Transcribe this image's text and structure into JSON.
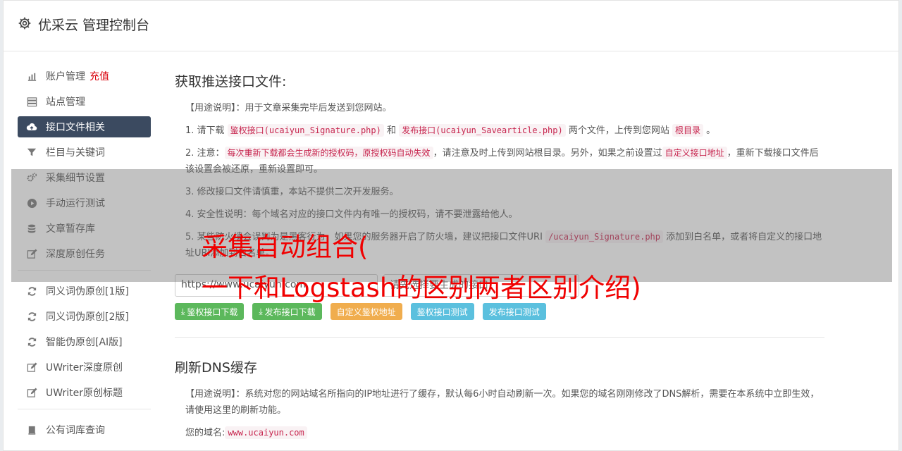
{
  "header": {
    "title": "优采云 管理控制台"
  },
  "sidebar": {
    "group1": [
      {
        "icon": "bar-chart-icon",
        "label": "账户管理",
        "extra": "充值"
      },
      {
        "icon": "server-icon",
        "label": "站点管理"
      },
      {
        "icon": "cloud-upload-icon",
        "label": "接口文件相关",
        "active": true
      },
      {
        "icon": "filter-icon",
        "label": "栏目与关键词"
      },
      {
        "icon": "gears-icon",
        "label": "采集细节设置"
      },
      {
        "icon": "play-icon",
        "label": "手动运行测试"
      },
      {
        "icon": "database-icon",
        "label": "文章暂存库"
      },
      {
        "icon": "edit-icon",
        "label": "深度原创任务"
      }
    ],
    "group2": [
      {
        "icon": "refresh-icon",
        "label": "同义词伪原创[1版]"
      },
      {
        "icon": "refresh-icon",
        "label": "同义词伪原创[2版]"
      },
      {
        "icon": "refresh-icon",
        "label": "智能伪原创[AI版]"
      },
      {
        "icon": "edit-icon",
        "label": "UWriter深度原创"
      },
      {
        "icon": "edit-icon",
        "label": "UWriter原创标题"
      }
    ],
    "group3": [
      {
        "icon": "book-icon",
        "label": "公有词库查询"
      }
    ]
  },
  "section1": {
    "title": "获取推送接口文件:",
    "usage": "【用途说明】：用于文章采集完毕后发送到您网站。",
    "item1": {
      "t1": "1. 请下载 ",
      "c1": "鉴权接口(ucaiyun_Signature.php)",
      "t2": " 和 ",
      "c2": "发布接口(ucaiyun_Savearticle.php)",
      "t3": " 两个文件，上传到您网站 ",
      "c3": "根目录",
      "t4": " 。"
    },
    "item2": {
      "t1": "2. 注意：",
      "c1": "每次重新下载都会生成新的授权码，原授权码自动失效",
      "t2": "，请注意及时上传到网站根目录。另外，如果之前设置过",
      "c2": "自定义接口地址",
      "t3": "，重新下载接口文件后该设置会被还原，重新设置即可。"
    },
    "item3": "3. 修改接口文件请慎重，本站不提供二次开发服务。",
    "item4": "4. 安全性说明：每个域名对应的接口文件内有唯一的授权码，请不要泄露给他人。",
    "item5": {
      "t1": "5. 某些防火墙会误判为是黑客行为，如果您的服务器开启了防火墙，建议把接口文件URI ",
      "c1": "/ucaiyun_Signature.php",
      "t2": " 添加到白名单，或者将自定义的接口地址URI添加到白名单。"
    },
    "protocol": "https://www.ucaiyun.com",
    "path_placeholder": "请先选择要生成的接口",
    "buttons": {
      "dl_auth": "鉴权接口下载",
      "dl_publish": "发布接口下载",
      "custom_auth": "自定义鉴权地址",
      "test_auth": "鉴权接口测试",
      "test_publish": "发布接口测试"
    }
  },
  "section2": {
    "title": "刷新DNS缓存",
    "usage": "【用途说明】：系统对您的网站域名所指向的IP地址进行了缓存，默认每6小时自动刷新一次。如果您的域名刚刚修改了DNS解析，需要在本系统中立即生效，请使用这里的刷新功能。",
    "domain_label": "您的域名:",
    "domain_value": "www.ucaiyun.com"
  },
  "overlay": {
    "line1": "采集自动组合(",
    "line2": "一下和Logstash的区别两者区别介绍)"
  }
}
